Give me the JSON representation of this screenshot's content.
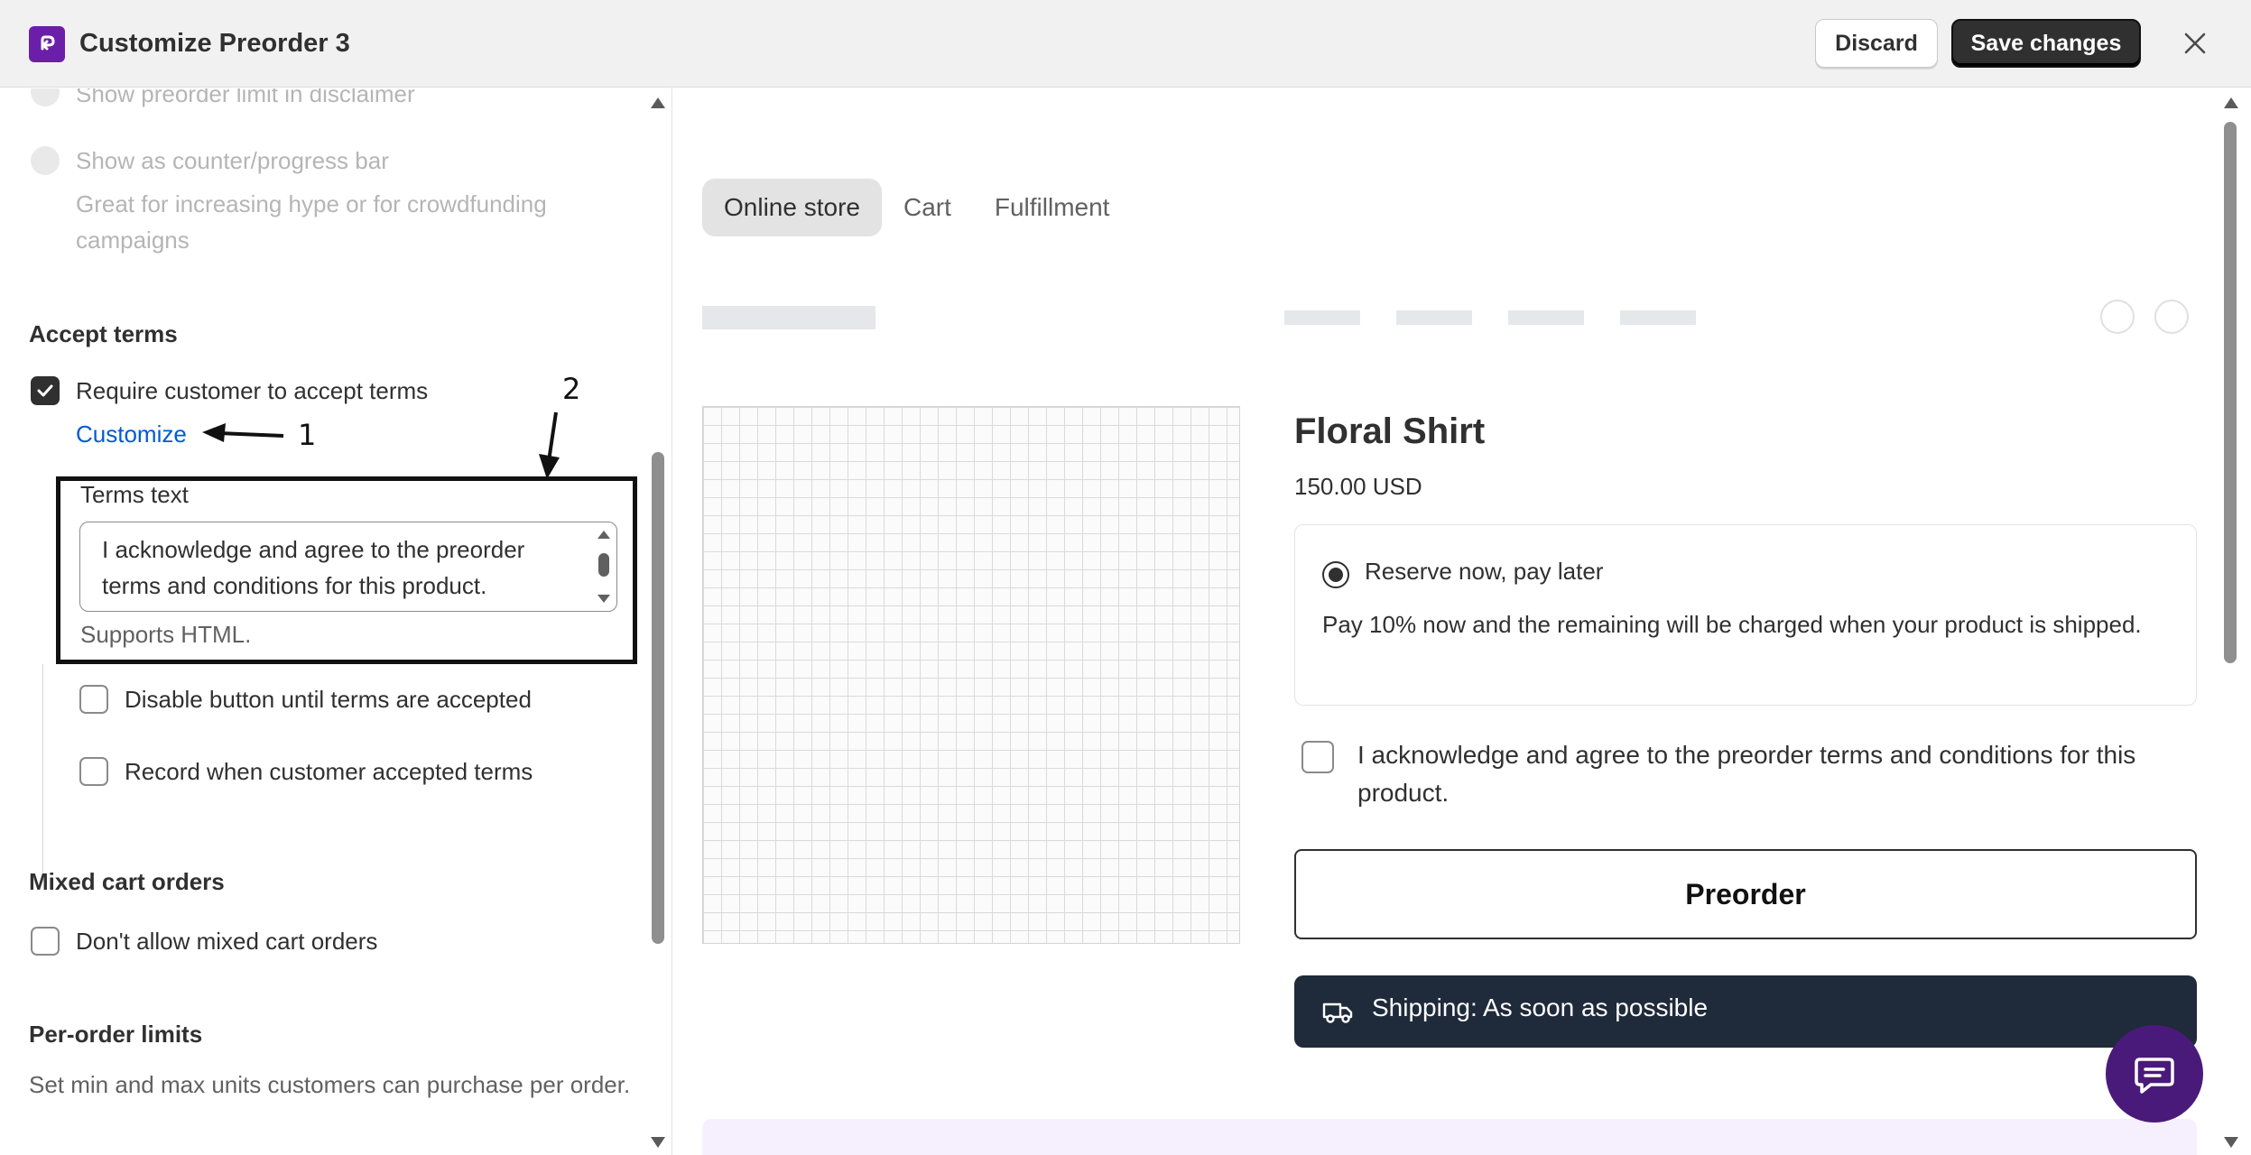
{
  "header": {
    "title": "Customize Preorder 3",
    "discard_label": "Discard",
    "save_label": "Save changes"
  },
  "left": {
    "show_limit_label": "Show preorder limit in disclaimer",
    "show_counter_label": "Show as counter/progress bar",
    "show_counter_desc": "Great for increasing hype or for crowdfunding campaigns",
    "accept_terms_heading": "Accept terms",
    "require_terms_label": "Require customer to accept terms",
    "require_terms_checked": true,
    "customize_link": "Customize",
    "annotation_1": "1",
    "annotation_2": "2",
    "terms_text_label": "Terms text",
    "terms_text_value": "I acknowledge and agree to the preorder terms and conditions for this product.",
    "supports_html": "Supports HTML.",
    "disable_button_label": "Disable button until terms are accepted",
    "record_accept_label": "Record when customer accepted terms",
    "mixed_cart_heading": "Mixed cart orders",
    "mixed_cart_label": "Don't allow mixed cart orders",
    "per_order_heading": "Per-order limits",
    "per_order_desc": "Set min and max units customers can purchase per order."
  },
  "preview": {
    "tabs": [
      {
        "label": "Online store",
        "active": true
      },
      {
        "label": "Cart",
        "active": false
      },
      {
        "label": "Fulfillment",
        "active": false
      }
    ],
    "product_title": "Floral Shirt",
    "price": "150.00 USD",
    "option_label": "Reserve now, pay later",
    "option_desc": "Pay 10% now and the remaining will be charged when your product is shipped.",
    "ack_text": "I acknowledge and agree to the preorder terms and conditions for this product.",
    "preorder_button": "Preorder",
    "shipping_text": "Shipping: As soon as possible"
  },
  "colors": {
    "brand_purple": "#6b1fa8",
    "link_blue": "#005bd3",
    "ship_bar": "#1f2a3a",
    "chat_bg": "#4a1a7a"
  }
}
